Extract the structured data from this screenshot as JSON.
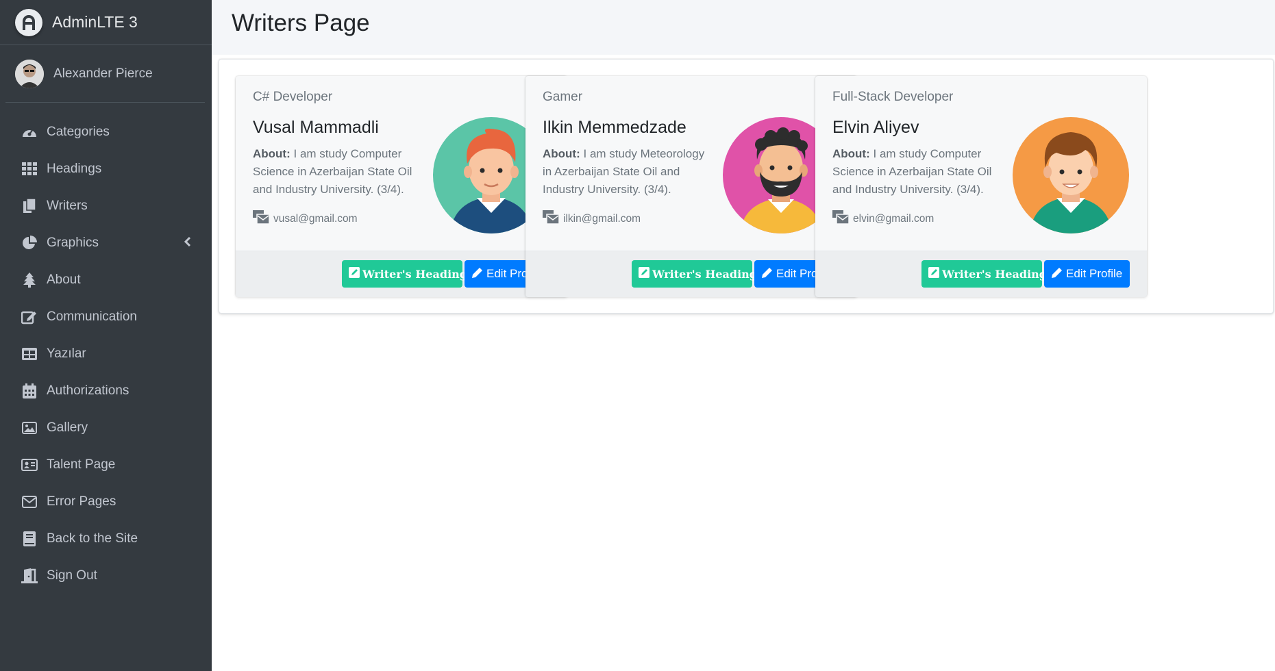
{
  "brand": {
    "name": "AdminLTE 3"
  },
  "user": {
    "name": "Alexander Pierce"
  },
  "sidebar": {
    "items": [
      {
        "label": "Categories",
        "icon": "dashboard-icon"
      },
      {
        "label": "Headings",
        "icon": "grid-icon"
      },
      {
        "label": "Writers",
        "icon": "copy-icon"
      },
      {
        "label": "Graphics",
        "icon": "pie-chart-icon",
        "has_caret": true
      },
      {
        "label": "About",
        "icon": "tree-icon"
      },
      {
        "label": "Communication",
        "icon": "edit-icon"
      },
      {
        "label": "Yazılar",
        "icon": "table-icon"
      },
      {
        "label": "Authorizations",
        "icon": "calendar-icon"
      },
      {
        "label": "Gallery",
        "icon": "image-icon"
      },
      {
        "label": "Talent Page",
        "icon": "id-card-icon"
      },
      {
        "label": "Error Pages",
        "icon": "envelope-icon"
      },
      {
        "label": "Back to the Site",
        "icon": "book-icon"
      },
      {
        "label": "Sign Out",
        "icon": "door-icon"
      }
    ]
  },
  "page": {
    "title": "Writers Page"
  },
  "writers": [
    {
      "role": "C# Developer",
      "name": "Vusal Mammadli",
      "about_label": "About:",
      "about": "I am study Computer Science in Azerbaijan State Oil and Industry University. (3/4).",
      "email": "vusal@gmail.com",
      "avatar_bg": "#5bc5a7",
      "headings_label": "Writer's Headings",
      "edit_label": "Edit Profile"
    },
    {
      "role": "Gamer",
      "name": "Ilkin Memmedzade",
      "about_label": "About:",
      "about": "I am study Meteorology in Azerbaijan State Oil and Industry University. (3/4).",
      "email": "ilkin@gmail.com",
      "avatar_bg": "#e052a8",
      "headings_label": "Writer's Headings",
      "edit_label": "Edit Profile"
    },
    {
      "role": "Full-Stack Developer",
      "name": "Elvin Aliyev",
      "about_label": "About:",
      "about": "I am study Computer Science in Azerbaijan State Oil and Industry University. (3/4).",
      "email": "elvin@gmail.com",
      "avatar_bg": "#f59a45",
      "headings_label": "Writer's Headings",
      "edit_label": "Edit Profile"
    }
  ],
  "colors": {
    "sidebar_bg": "#343a40",
    "success": "#20c997",
    "primary": "#007bff"
  }
}
